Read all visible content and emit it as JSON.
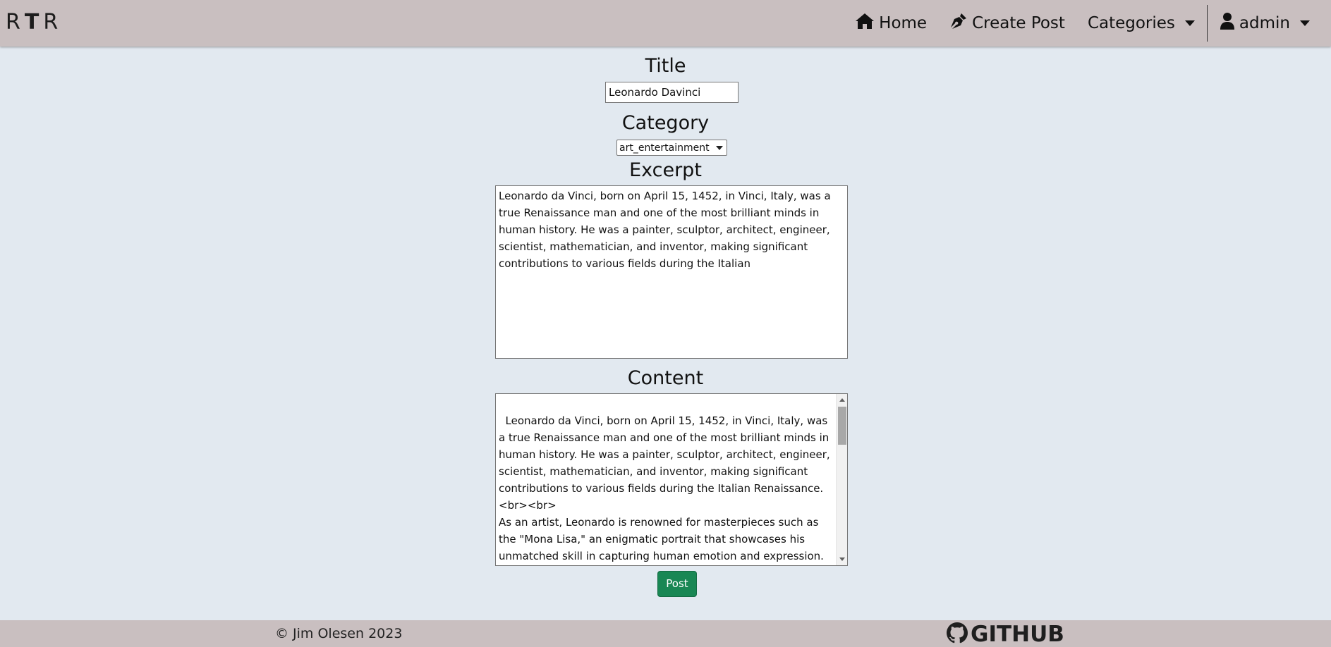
{
  "navbar": {
    "brand": [
      "R",
      "T",
      "R"
    ],
    "items": [
      {
        "label": "Home",
        "icon": "home-icon"
      },
      {
        "label": "Create Post",
        "icon": "pen-nib-icon"
      },
      {
        "label": "Categories",
        "icon": "caret-down-icon"
      },
      {
        "label": "admin",
        "icon": "user-icon"
      }
    ]
  },
  "form": {
    "title_label": "Title",
    "title_value": "Leonardo Davinci",
    "category_label": "Category",
    "category_selected": "art_entertainment",
    "excerpt_label": "Excerpt",
    "excerpt_value": "Leonardo da Vinci, born on April 15, 1452, in Vinci, Italy, was a true Renaissance man and one of the most brilliant minds in human history. He was a painter, sculptor, architect, engineer, scientist, mathematician, and inventor, making significant contributions to various fields during the Italian",
    "content_label": "Content",
    "content_value": "Leonardo da Vinci, born on April 15, 1452, in Vinci, Italy, was a true Renaissance man and one of the most brilliant minds in human history. He was a painter, sculptor, architect, engineer, scientist, mathematician, and inventor, making significant contributions to various fields during the Italian Renaissance.\n<br><br>\nAs an artist, Leonardo is renowned for masterpieces such as the \"Mona Lisa,\" an enigmatic portrait that showcases his unmatched skill in capturing human emotion and expression. Another iconic work, \"The Last Supper,\" demonstrates his ability to convey",
    "submit_label": "Post"
  },
  "footer": {
    "copyright": "© Jim Olesen 2023",
    "github_label": "GITHUB"
  },
  "colors": {
    "navbar_bg": "#c9bfc0",
    "page_bg": "#e2e9f0",
    "post_button": "#198754"
  }
}
